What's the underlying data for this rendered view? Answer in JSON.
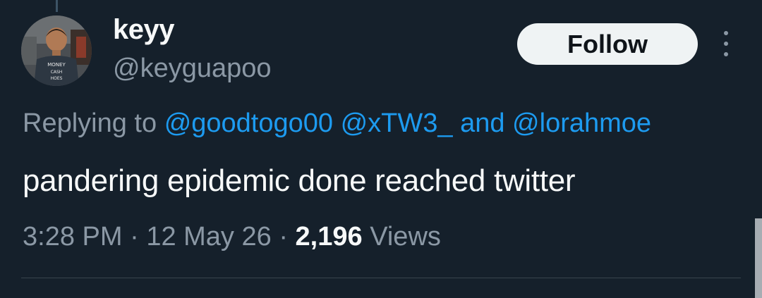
{
  "tweet": {
    "author": {
      "display_name": "keyy",
      "handle": "@keyguapoo",
      "avatar_shirt_text": [
        "MONEY",
        "CASH",
        "HOES"
      ]
    },
    "follow_label": "Follow",
    "more_icon": "more-vertical-icon",
    "replying_to_prefix": "Replying to",
    "mentions": [
      "@goodtogo00",
      "@xTW3_"
    ],
    "mentions_joiner": "and",
    "last_mention": "@lorahmoe",
    "text": "pandering epidemic done reached twitter",
    "time": "3:28 PM",
    "separator": "·",
    "date": "12 May 26",
    "views_count": "2,196",
    "views_label": "Views"
  },
  "colors": {
    "background": "#15202b",
    "text": "#f7f9f9",
    "secondary_text": "#8b98a5",
    "link": "#1d9bf0",
    "follow_button_bg": "#eff3f4",
    "follow_button_text": "#0f1419",
    "divider": "#38444d"
  }
}
